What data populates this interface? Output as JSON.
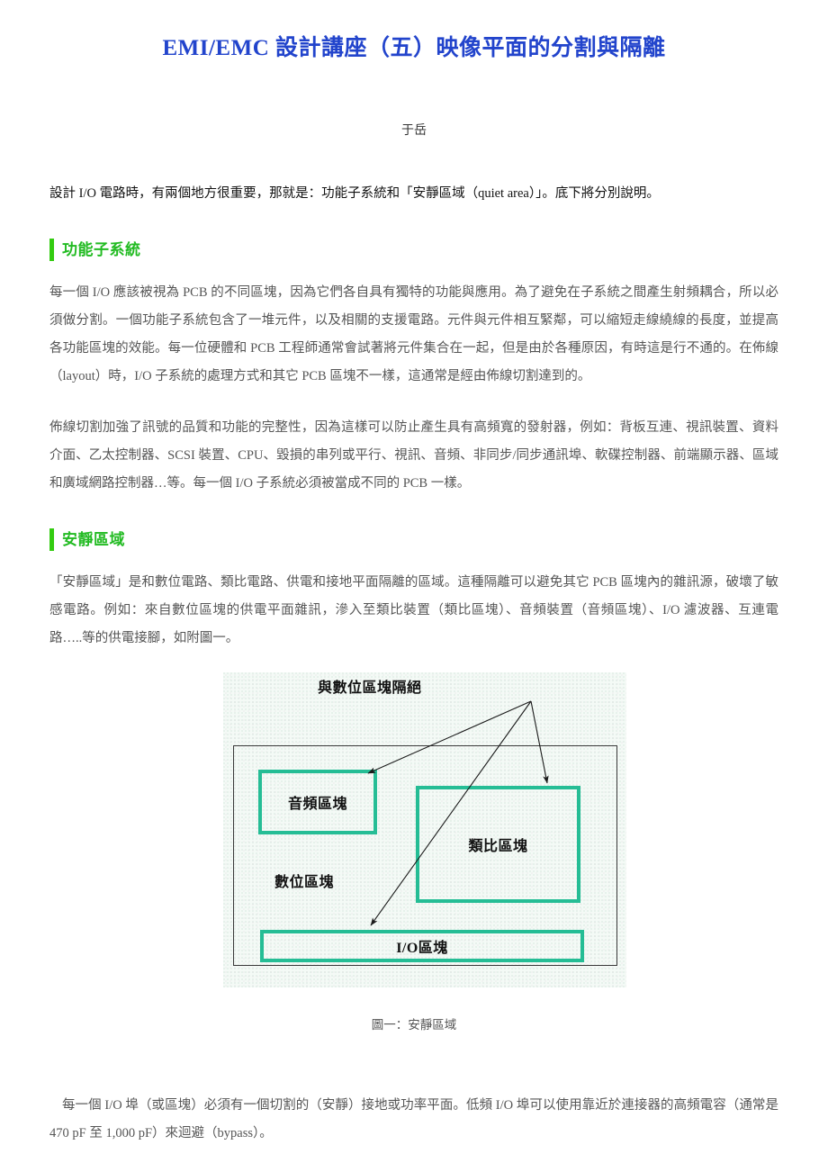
{
  "document": {
    "title": "EMI/EMC 設計講座（五）映像平面的分割與隔離",
    "author": "于岳",
    "title_color": "#2244cc",
    "heading_color": "#22bb22",
    "heading_bar_color": "#33cc11",
    "body_color": "#555555"
  },
  "intro": {
    "text": "設計 I/O 電路時，有兩個地方很重要，那就是：功能子系統和「安靜區域（quiet area）」。底下將分別說明。"
  },
  "sections": [
    {
      "heading": "功能子系統",
      "paragraphs": [
        "每一個 I/O 應該被視為 PCB 的不同區塊，因為它們各自具有獨特的功能與應用。為了避免在子系統之間產生射頻耦合，所以必須做分割。一個功能子系統包含了一堆元件，以及相關的支援電路。元件與元件相互緊鄰，可以縮短走線繞線的長度，並提高各功能區塊的效能。每一位硬體和 PCB 工程師通常會試著將元件集合在一起，但是由於各種原因，有時這是行不通的。在佈線（layout）時，I/O 子系統的處理方式和其它 PCB 區塊不一樣，這通常是經由佈線切割達到的。",
        "佈線切割加強了訊號的品質和功能的完整性，因為這樣可以防止產生具有高頻寬的發射器，例如：背板互連、視訊裝置、資料介面、乙太控制器、SCSI 裝置、CPU、毀損的串列或平行、視訊、音頻、非同步/同步通訊埠、軟碟控制器、前端顯示器、區域和廣域網路控制器…等。每一個 I/O 子系統必須被當成不同的 PCB 一樣。"
      ]
    },
    {
      "heading": "安靜區域",
      "paragraphs": [
        "「安靜區域」是和數位電路、類比電路、供電和接地平面隔離的區域。這種隔離可以避免其它 PCB 區塊內的雜訊源，破壞了敏感電路。例如：來自數位區塊的供電平面雜訊，滲入至類比裝置（類比區塊）、音頻裝置（音頻區塊）、I/O 濾波器、互連電路…..等的供電接腳，如附圖一。"
      ]
    }
  ],
  "figure": {
    "caption": "圖一：安靜區域",
    "annotation": "與數位區塊隔絕",
    "outer_label": "數位區塊",
    "blocks": [
      {
        "label": "音頻區塊",
        "name": "audio-block"
      },
      {
        "label": "類比區塊",
        "name": "analog-block"
      },
      {
        "label": "I/O區塊",
        "name": "io-block"
      }
    ],
    "box_border_color": "#25bd95",
    "outer_border_color": "#3a3a3a",
    "background_color": "#f4faf6"
  },
  "closing": {
    "text": "每一個 I/O 埠（或區塊）必須有一個切割的（安靜）接地或功率平面。低頻 I/O 埠可以使用靠近於連接器的高頻電容（通常是 470 pF 至 1,000 pF）來迴避（bypass）。"
  }
}
